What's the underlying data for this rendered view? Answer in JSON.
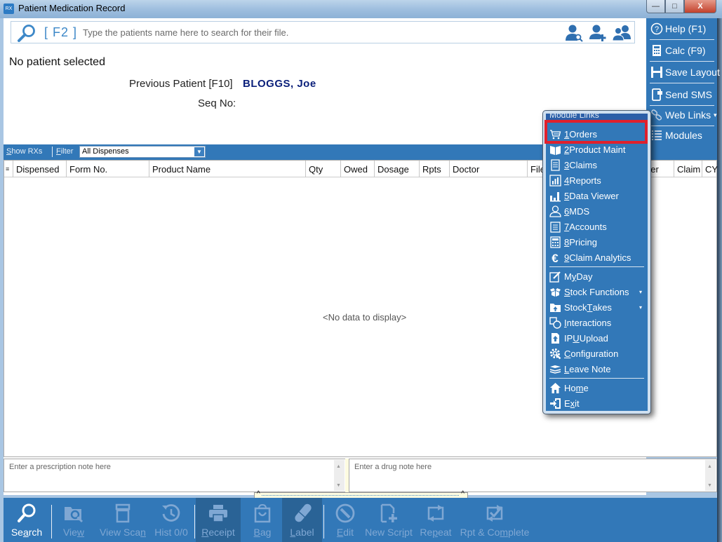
{
  "window": {
    "title": "Patient Medication Record",
    "app_icon_text": "RX",
    "minimize_glyph": "—",
    "maximize_glyph": "□",
    "close_glyph": "X"
  },
  "search": {
    "hotkey_label": "[ F2 ]",
    "placeholder": "Type the patients name here to search for their file.",
    "value": "",
    "icons": [
      "find-patient-icon",
      "add-patient-icon",
      "patient-group-icon"
    ]
  },
  "patient": {
    "status": "No patient selected",
    "previous_label": "Previous Patient [F10]",
    "previous_name": "BLOGGS, Joe",
    "seq_label": "Seq No:",
    "seq_value": ""
  },
  "rx_strip": {
    "show_rxs": {
      "accel": "S",
      "rest": "how RXs"
    },
    "filter": {
      "accel": "F",
      "rest": "ilter"
    },
    "filter_value": "All Dispenses",
    "filter_arrow": "▼"
  },
  "grid": {
    "chooser_glyph": "≡",
    "columns": [
      "Dispensed",
      "Form No.",
      "Product Name",
      "Qty",
      "Owed",
      "Dosage",
      "Rpts",
      "Doctor",
      "File",
      "der",
      "Claim",
      "CY"
    ],
    "empty_text": "<No data to display>"
  },
  "notes": {
    "prescription_placeholder": "Enter a prescription note here",
    "drug_placeholder": "Enter a drug note here",
    "scroll_up": "▲",
    "scroll_down": "▼",
    "splitter_caret": "^"
  },
  "right_panel": {
    "items": [
      {
        "label": "Help (F1)",
        "icon": "help-icon"
      },
      {
        "label": "Calc (F9)",
        "icon": "calculator-icon"
      },
      {
        "label": "Save Layout",
        "icon": "save-icon"
      },
      {
        "label": "Send SMS",
        "icon": "sms-icon"
      },
      {
        "label": "Web Links",
        "icon": "link-icon",
        "submenu": "▾"
      },
      {
        "label": "Modules",
        "icon": "modules-icon"
      }
    ]
  },
  "module_menu": {
    "header": "Module Links",
    "highlighted_item": "1 Orders",
    "highlight_color": "#e0202c",
    "items": [
      {
        "accel": "1",
        "label": " Orders",
        "icon": "cart-icon"
      },
      {
        "accel": "2",
        "label": " Product Maint",
        "icon": "box-icon"
      },
      {
        "accel": "3",
        "label": " Claims",
        "icon": "scroll-icon"
      },
      {
        "accel": "4",
        "label": " Reports",
        "icon": "report-icon"
      },
      {
        "accel": "5",
        "label": " Data Viewer",
        "icon": "bar-chart-icon"
      },
      {
        "accel": "6",
        "label": " MDS",
        "icon": "person-icon"
      },
      {
        "accel": "7",
        "label": " Accounts",
        "icon": "notepad-icon"
      },
      {
        "accel": "8",
        "label": " Pricing",
        "icon": "calculator-icon"
      },
      {
        "accel": "9",
        "label": " Claim Analytics",
        "icon": "euro-icon"
      },
      {
        "pre": "M",
        "accel": "y",
        "label": " Day",
        "icon": "edit-note-icon"
      },
      {
        "pre": "",
        "accel": "S",
        "label": "tock Functions",
        "icon": "boxes-icon",
        "submenu": "▾"
      },
      {
        "pre": "Stock ",
        "accel": "T",
        "label": "akes",
        "icon": "folder-up-icon",
        "submenu": "▾"
      },
      {
        "pre": "",
        "accel": "I",
        "label": "nteractions",
        "icon": "interactions-icon"
      },
      {
        "pre": "IP",
        "accel": "U",
        "label": " Upload",
        "icon": "upload-icon"
      },
      {
        "pre": "",
        "accel": "C",
        "label": "onfiguration",
        "icon": "gear-wrench-icon"
      },
      {
        "pre": "",
        "accel": "L",
        "label": "eave Note",
        "icon": "layers-icon"
      },
      {
        "pre": "Ho",
        "accel": "m",
        "label": "e",
        "icon": "home-icon"
      },
      {
        "pre": "E",
        "accel": "x",
        "label": "it",
        "icon": "exit-icon"
      }
    ]
  },
  "bottom_toolbar": {
    "buttons": [
      {
        "pre": "Se",
        "accel": "a",
        "post": "rch",
        "icon": "search-icon",
        "enabled": true
      },
      {
        "pre": "Vie",
        "accel": "w",
        "post": "",
        "icon": "folder-search-icon",
        "enabled": false
      },
      {
        "pre": "View Sca",
        "accel": "n",
        "post": "",
        "icon": "scanner-icon",
        "enabled": false
      },
      {
        "pre": "Hist 0/0",
        "accel": "",
        "post": "",
        "icon": "history-icon",
        "enabled": false
      },
      {
        "pre": "",
        "accel": "R",
        "post": "eceipt",
        "icon": "printer-icon",
        "enabled": false
      },
      {
        "pre": "",
        "accel": "B",
        "post": "ag",
        "icon": "bag-icon",
        "enabled": false
      },
      {
        "pre": "",
        "accel": "L",
        "post": "abel",
        "icon": "pill-icon",
        "enabled": false
      },
      {
        "pre": "",
        "accel": "E",
        "post": "dit",
        "icon": "edit-icon",
        "enabled": false
      },
      {
        "pre": "New Scr",
        "accel": "i",
        "post": "pt",
        "icon": "new-script-icon",
        "enabled": false
      },
      {
        "pre": "Re",
        "accel": "p",
        "post": "eat",
        "icon": "repeat-icon",
        "enabled": false
      },
      {
        "pre": "Rpt & Co",
        "accel": "m",
        "post": "plete",
        "icon": "repeat-complete-icon",
        "enabled": false
      }
    ]
  }
}
